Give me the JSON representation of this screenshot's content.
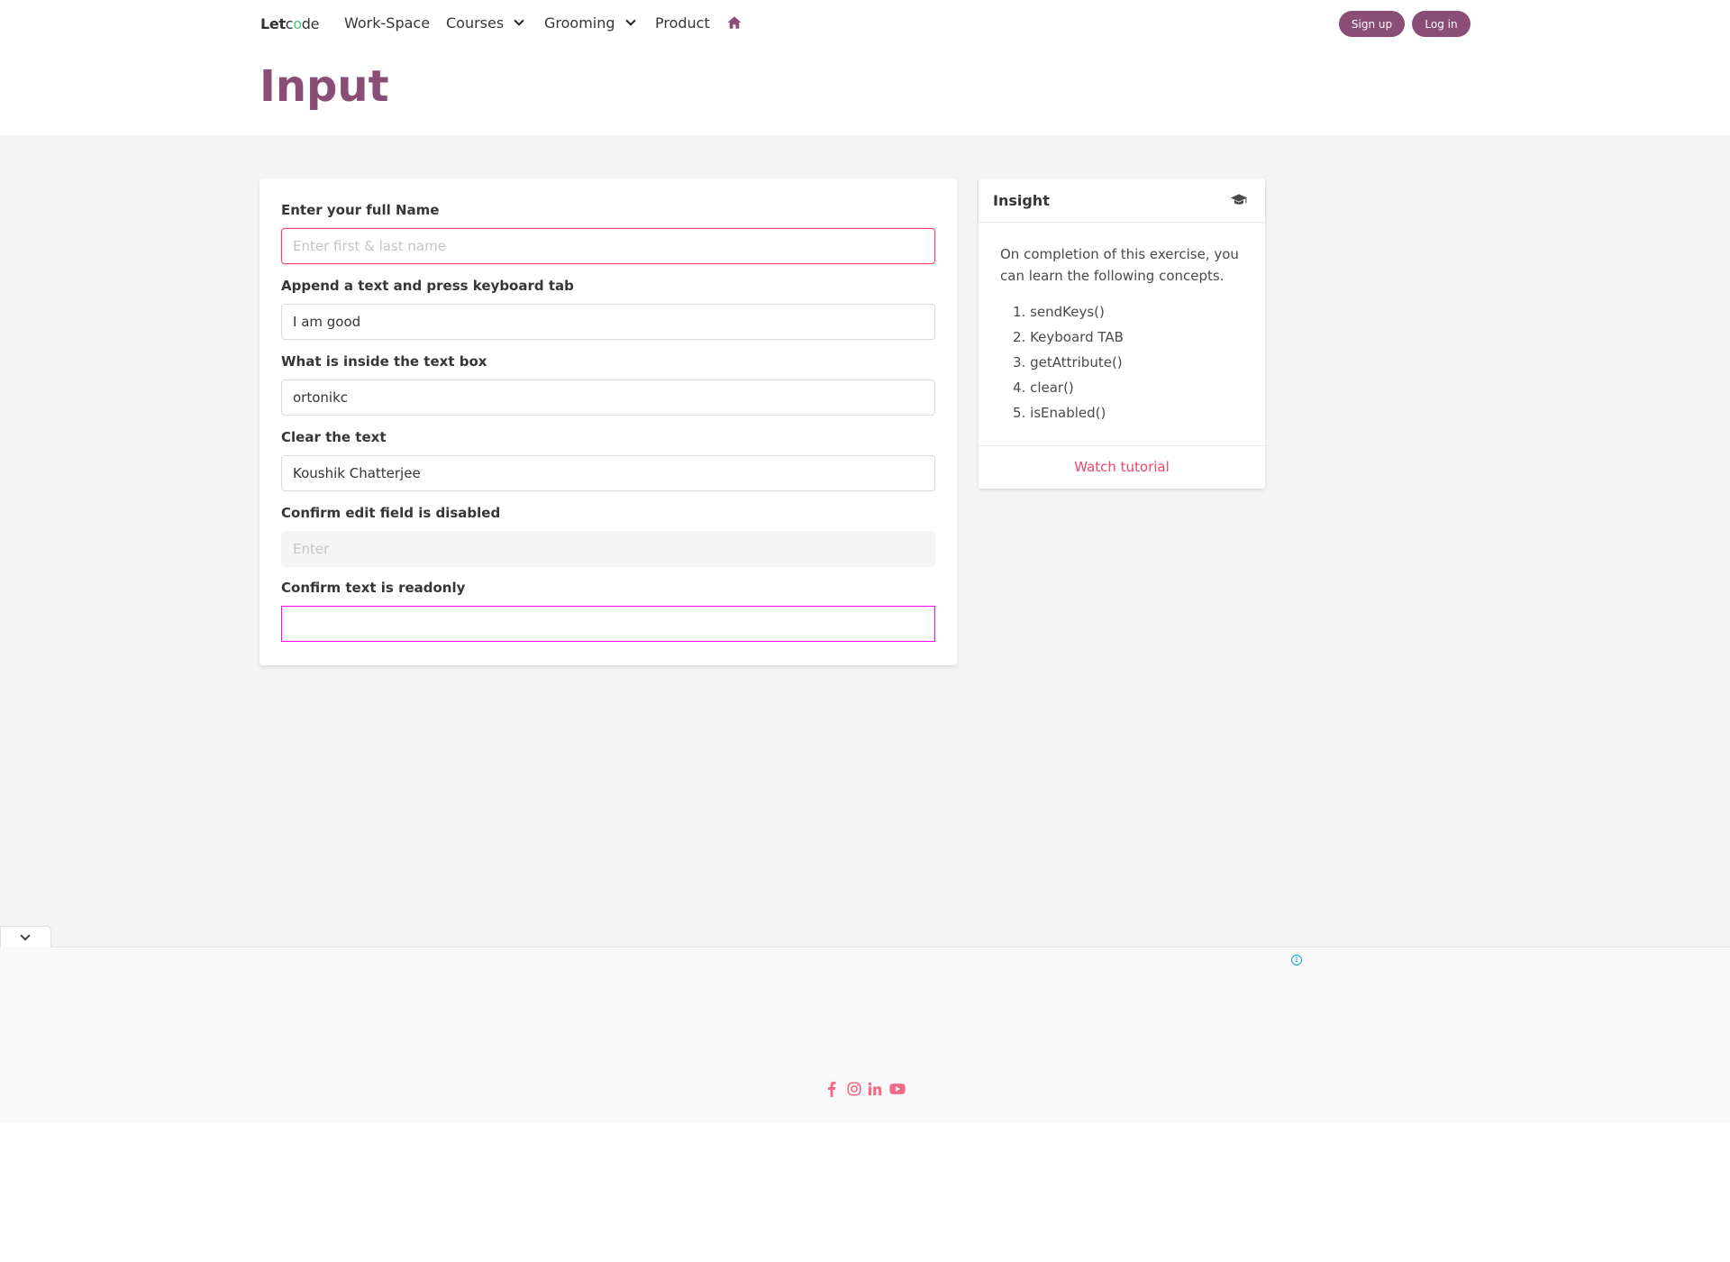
{
  "nav": {
    "logo": {
      "part1": "Let",
      "part2": "c",
      "part3": "o",
      "part4": "de"
    },
    "items": [
      {
        "label": "Work-Space"
      },
      {
        "label": "Courses"
      },
      {
        "label": "Grooming"
      },
      {
        "label": "Product"
      }
    ],
    "signup_label": "Sign up",
    "login_label": "Log in"
  },
  "hero": {
    "title": "Input"
  },
  "form": {
    "fields": [
      {
        "label": "Enter your full Name",
        "value": "",
        "placeholder": "Enter first & last name"
      },
      {
        "label": "Append a text and press keyboard tab",
        "value": "I am good",
        "placeholder": ""
      },
      {
        "label": "What is inside the text box",
        "value": "ortonikc",
        "placeholder": ""
      },
      {
        "label": "Clear the text",
        "value": "Koushik Chatterjee",
        "placeholder": ""
      },
      {
        "label": "Confirm edit field is disabled",
        "value": "",
        "placeholder": "Enter"
      },
      {
        "label": "Confirm text is readonly",
        "value": "",
        "placeholder": ""
      }
    ]
  },
  "insight": {
    "title": "Insight",
    "description": "On completion of this exercise, you can learn the following concepts.",
    "concepts": [
      "1. sendKeys()",
      "2. Keyboard TAB",
      "3. getAttribute()",
      "4. clear()",
      "5. isEnabled()"
    ],
    "watch_label": "Watch tutorial"
  },
  "colors": {
    "brand": "#8a4d76",
    "link": "#f14668",
    "readonly_border": "#ff00ff",
    "success": "#48c774"
  },
  "icons": {
    "home": "home-icon",
    "graduation": "graduation-cap-icon",
    "social": [
      "facebook-icon",
      "instagram-icon",
      "linkedin-icon",
      "youtube-icon"
    ]
  }
}
